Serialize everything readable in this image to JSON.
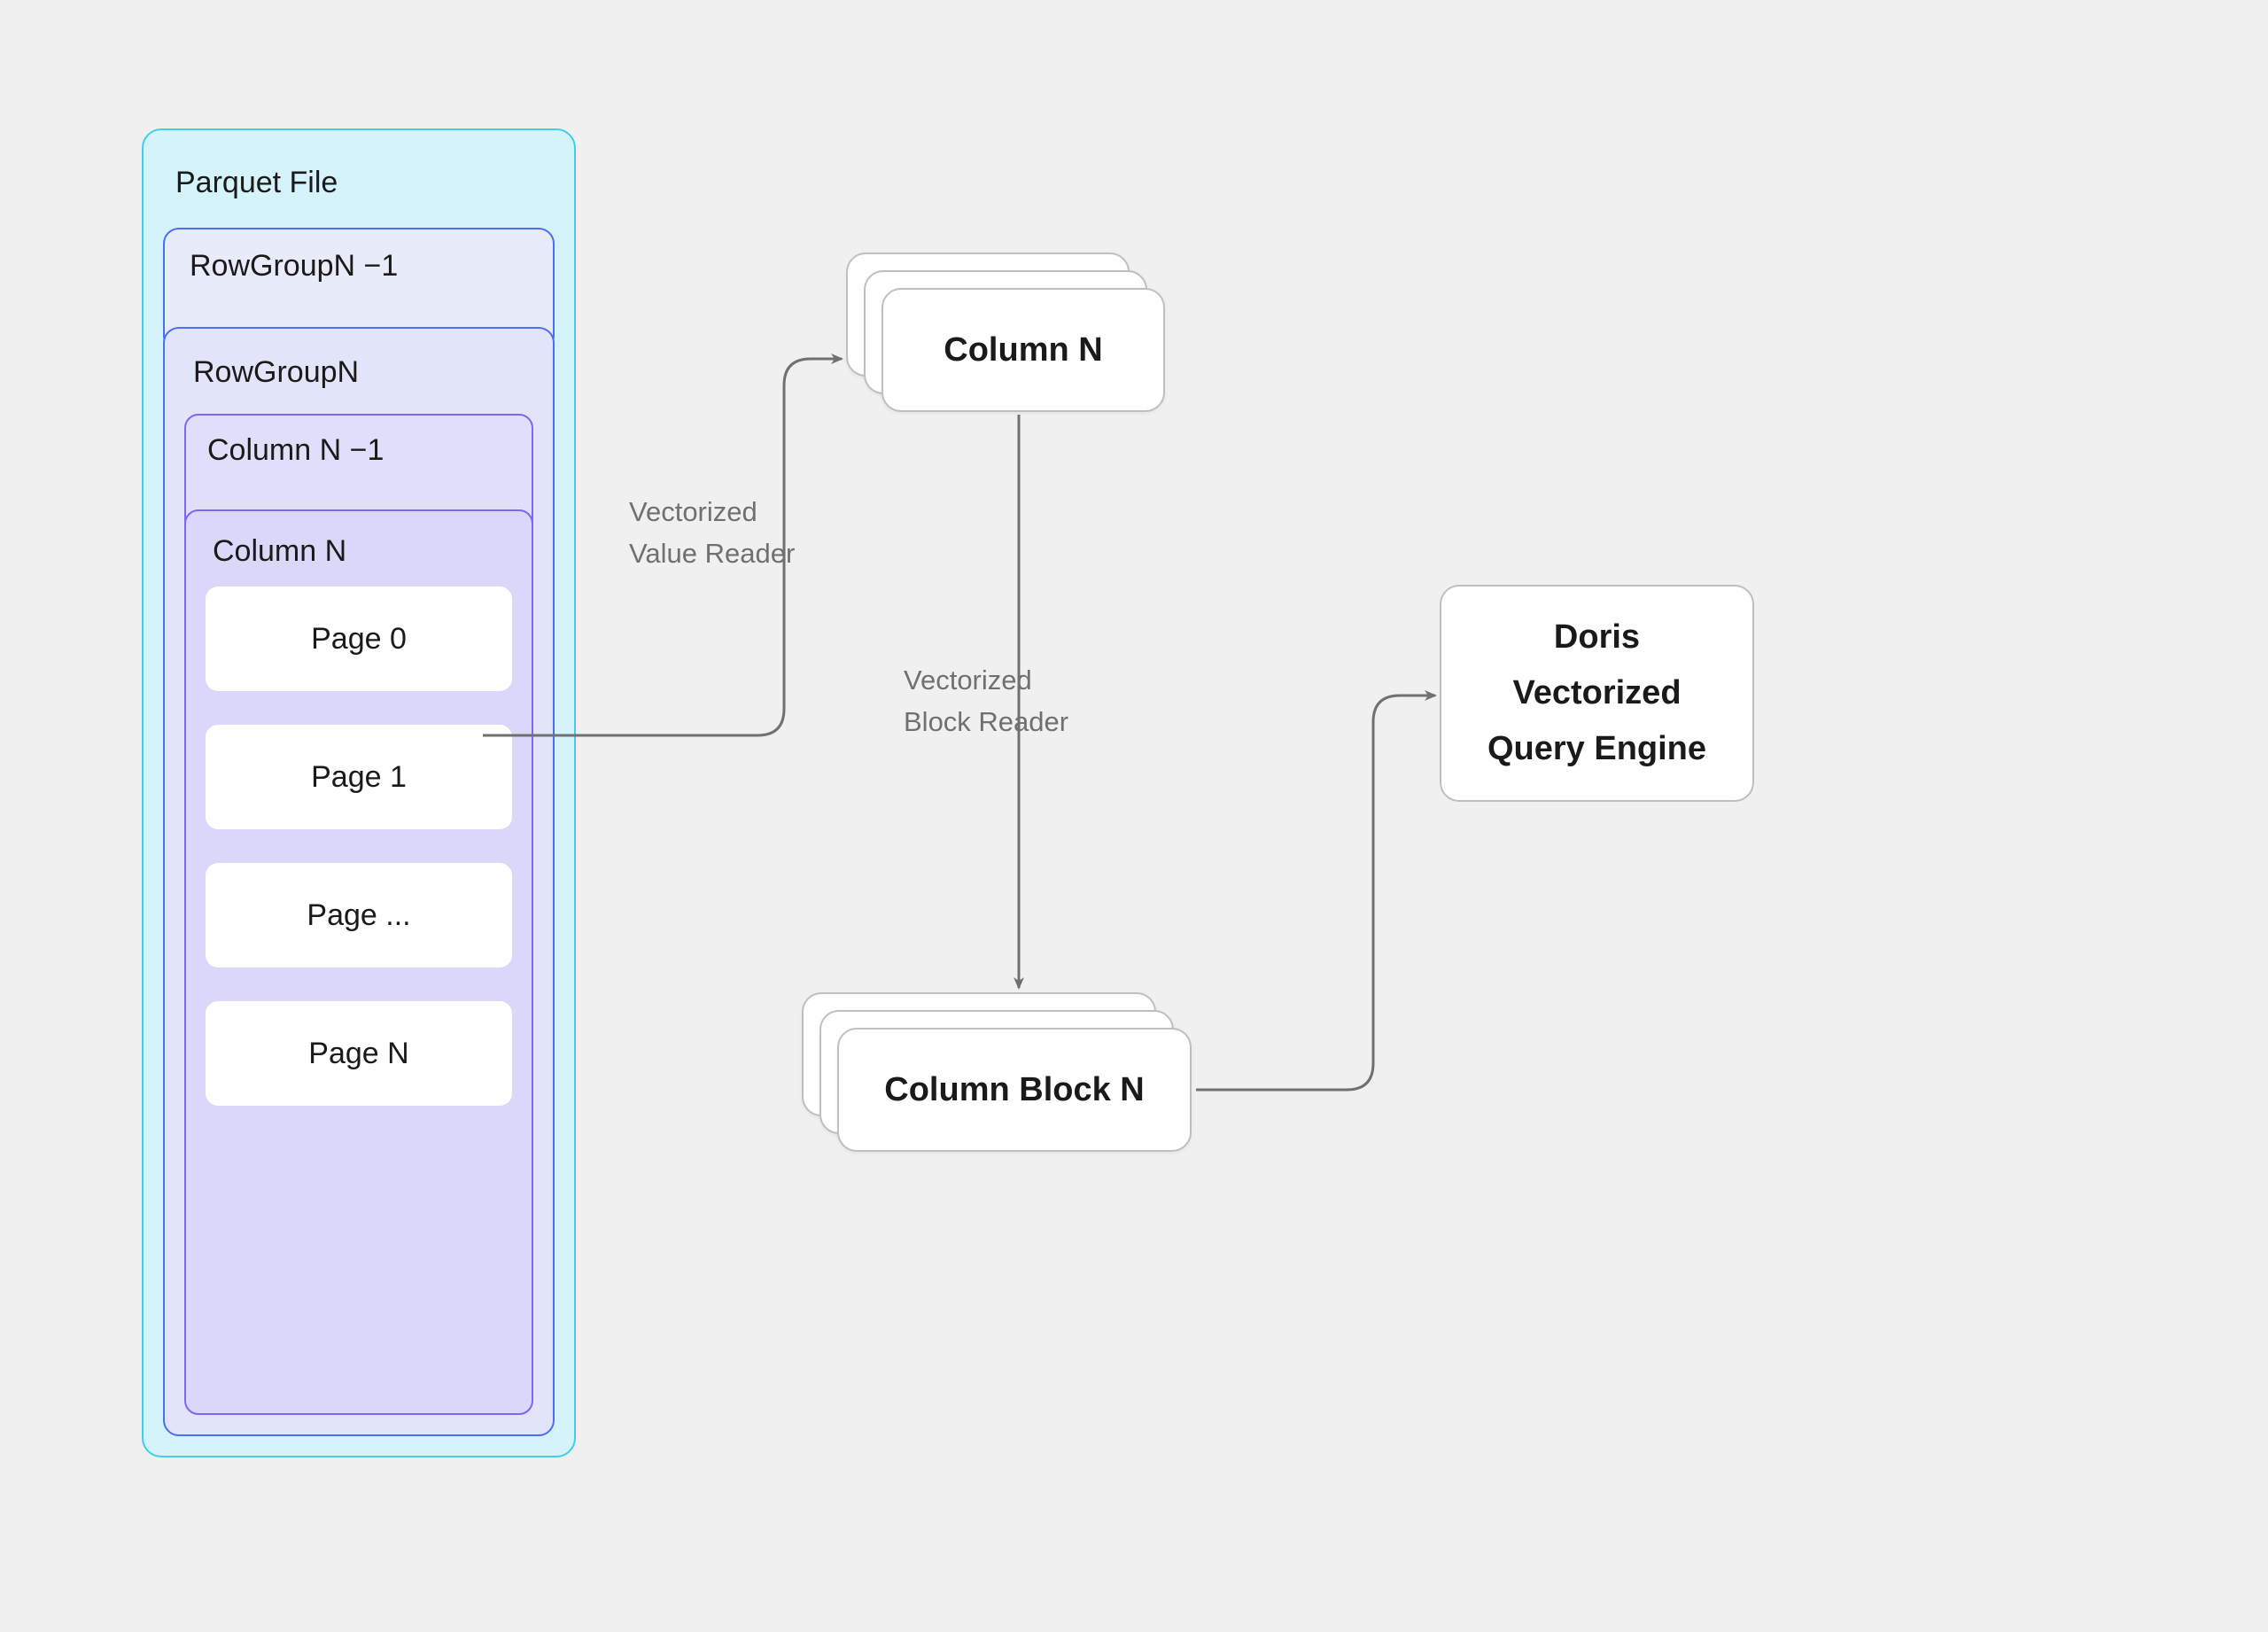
{
  "parquet": {
    "title": "Parquet File",
    "rowgroup_back": "RowGroupN −1",
    "rowgroup_front": "RowGroupN",
    "column_back": "Column N −1",
    "column_front": "Column N",
    "pages": [
      "Page 0",
      "Page 1",
      "Page ...",
      "Page N"
    ]
  },
  "nodes": {
    "column_n": "Column N",
    "column_block_n": "Column Block N",
    "doris_line1": "Doris",
    "doris_line2": "Vectorized",
    "doris_line3": "Query Engine"
  },
  "edges": {
    "value_reader_l1": "Vectorized",
    "value_reader_l2": "Value Reader",
    "block_reader_l1": "Vectorized",
    "block_reader_l2": "Block Reader"
  },
  "colors": {
    "bg": "#f0f0f0",
    "parquet_fill": "#d4f3fb",
    "parquet_border": "#3dd0e8",
    "rowgroup_fill": "#e2e5fa",
    "rowgroup_border": "#4a6ef5",
    "column_fill": "#dad8f9",
    "column_border": "#7b67f0",
    "card_border": "#bfbfbf",
    "arrow": "#707070",
    "label": "#707070"
  }
}
